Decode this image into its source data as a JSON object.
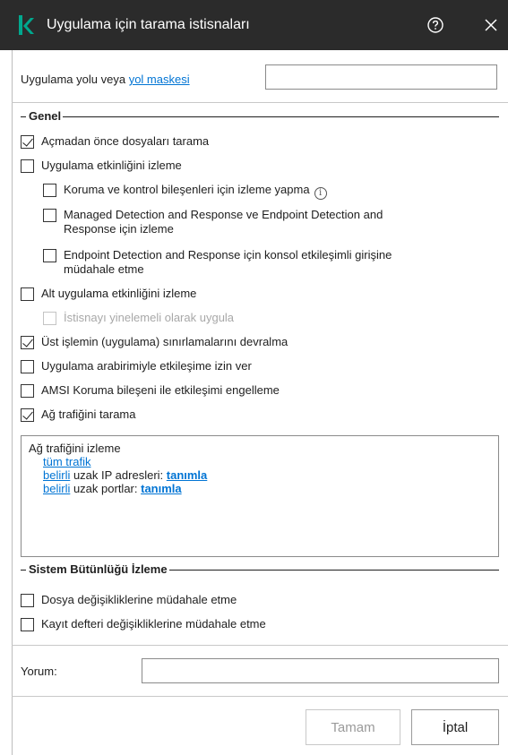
{
  "window": {
    "title": "Uygulama için tarama istisnaları",
    "icons": {
      "logo": "kaspersky-k-logo",
      "help": "help-icon",
      "close": "close-icon"
    },
    "accent_color": "#00a88e"
  },
  "app_path": {
    "label_prefix": "Uygulama yolu veya",
    "label_link": "yol maskesi",
    "value": ""
  },
  "general": {
    "title": "Genel",
    "options": [
      {
        "label": "Açmadan önce dosyaları tarama",
        "checked": true,
        "disabled": false
      },
      {
        "label": "Uygulama etkinliğini izleme",
        "checked": false,
        "disabled": false
      },
      {
        "label": "Koruma ve kontrol bileşenleri için izleme yapma",
        "checked": false,
        "disabled": false
      },
      {
        "label_line1": "Managed Detection and Response ve Endpoint Detection and",
        "label_line2": "Response için izleme",
        "checked": false,
        "disabled": false
      },
      {
        "label_line1": "Endpoint Detection and Response için konsol etkileşimli girişine",
        "label_line2": "müdahale etme",
        "checked": false,
        "disabled": false
      },
      {
        "label": "Alt uygulama etkinliğini izleme",
        "checked": false,
        "disabled": false
      },
      {
        "label": "İstisnayı yinelemeli olarak uygula",
        "checked": false,
        "disabled": true
      },
      {
        "label": "Üst işlemin (uygulama) sınırlamalarını devralma",
        "checked": true,
        "disabled": false
      },
      {
        "label": "Uygulama arabirimiyle etkileşime izin ver",
        "checked": false,
        "disabled": false
      },
      {
        "label": "AMSI Koruma bileşeni ile etkileşimi engelleme",
        "checked": false,
        "disabled": false
      },
      {
        "label": "Ağ trafiğini tarama",
        "checked": true,
        "disabled": false
      }
    ]
  },
  "traffic": {
    "heading": "Ağ trafiğini izleme",
    "all_traffic": "tüm trafik",
    "ip_prefix_link": "belirli",
    "ip_text": " uzak IP adresleri: ",
    "ip_define": "tanımla",
    "port_prefix_link": "belirli",
    "port_text": " uzak portlar: ",
    "port_define": "tanımla"
  },
  "integrity": {
    "title": "Sistem Bütünlüğü İzleme",
    "options": [
      {
        "label": "Dosya değişikliklerine müdahale etme",
        "checked": false
      },
      {
        "label": "Kayıt defteri değişikliklerine müdahale etme",
        "checked": false
      }
    ]
  },
  "comment": {
    "label": "Yorum:",
    "value": ""
  },
  "buttons": {
    "ok": "Tamam",
    "cancel": "İptal",
    "ok_enabled": false
  }
}
